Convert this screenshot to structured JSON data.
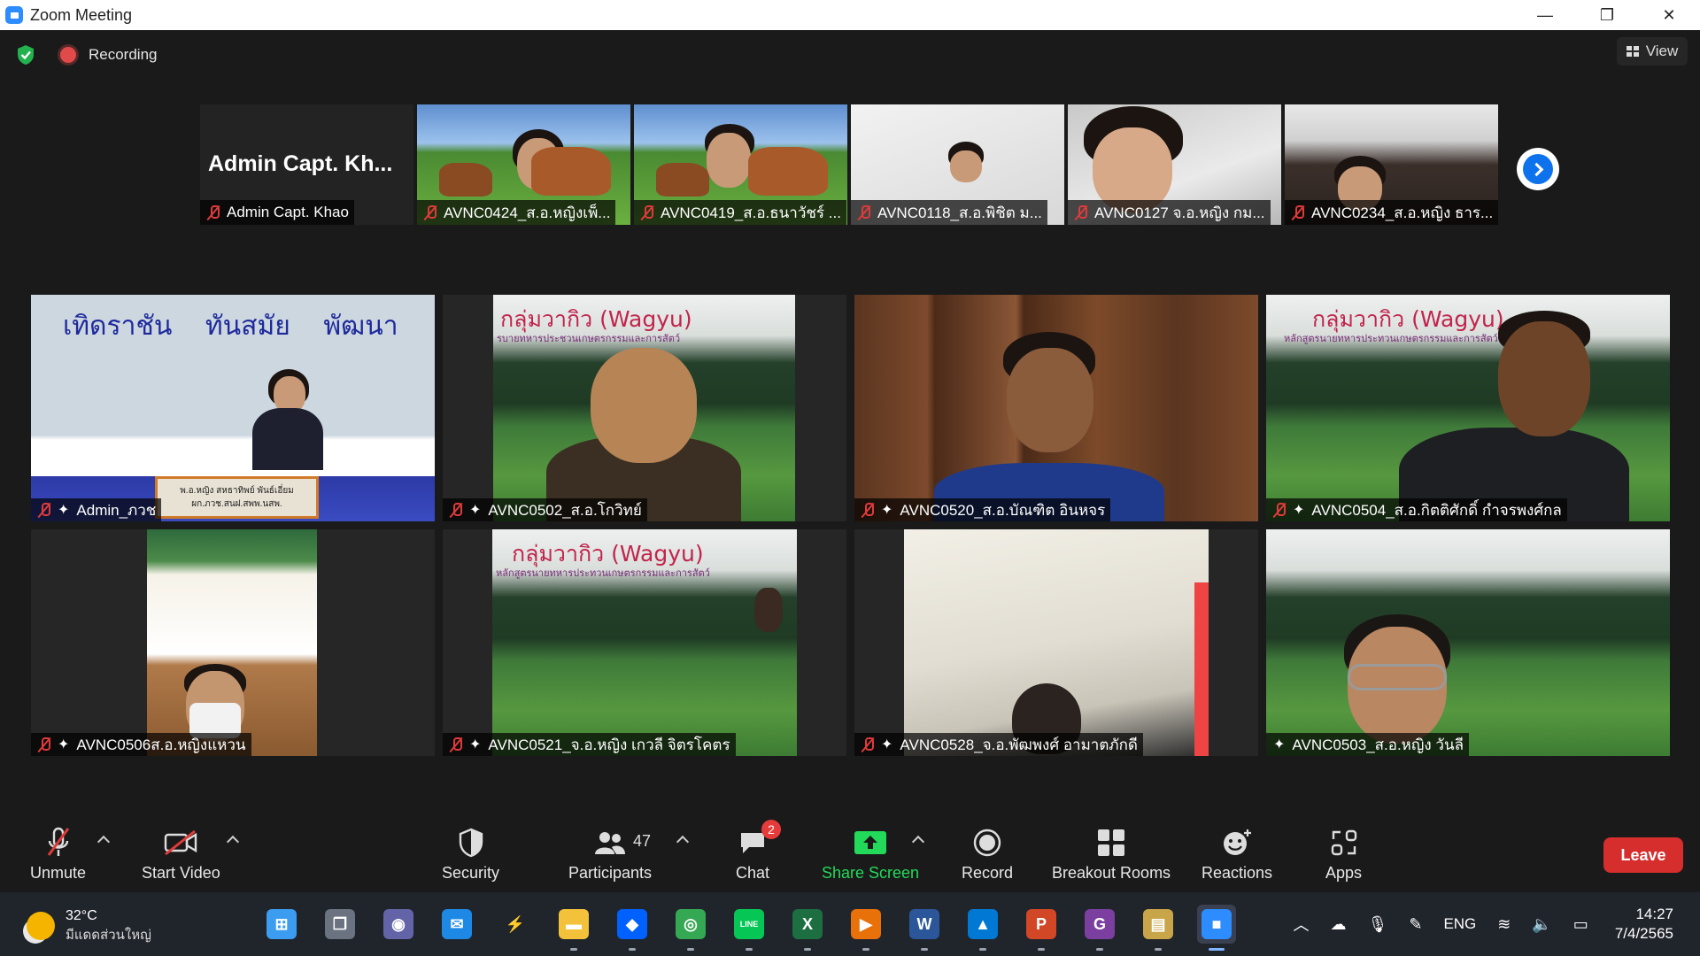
{
  "window": {
    "title": "Zoom Meeting",
    "minimize": "—",
    "maximize": "❐",
    "close": "✕"
  },
  "meeting": {
    "recording_label": "Recording",
    "view_label": "View"
  },
  "filmstrip": [
    {
      "name": "Admin Capt. Khao",
      "big_name": "Admin Capt. Kh...",
      "muted": true
    },
    {
      "name": "AVNC0424_ส.อ.หญิงเพ็...",
      "muted": true
    },
    {
      "name": "AVNC0419_ส.อ.ธนาวัชร์ ...",
      "muted": true
    },
    {
      "name": "AVNC0118_ส.อ.พิชิต ม...",
      "muted": true
    },
    {
      "name": "AVNC0127 จ.อ.หญิง กม...",
      "muted": true
    },
    {
      "name": "AVNC0234_ส.อ.หญิง ธาร...",
      "muted": true
    }
  ],
  "gallery": [
    {
      "name": "Admin_ภวช",
      "muted": true,
      "stage_text": "เทิดราชัน ทันสมัย พัฒนา",
      "nameplate_1": "พ.อ.หญิง สหธาทิพย์ พันธ์เอี่ยม",
      "nameplate_2": "ผก.ภวช.สนฝ.สพพ.นสพ."
    },
    {
      "name": "AVNC0502_ส.อ.โกวิทย์",
      "muted": true,
      "title": "กลุ่มวากิว (Wagyu)",
      "subtitle": "รบายทหารประชวนเกษตรกรรมและการสัตว์"
    },
    {
      "name": "AVNC0520_ส.อ.บัณฑิต อินหจร",
      "muted": true
    },
    {
      "name": "AVNC0504_ส.อ.กิตติศักดิ์ กำจรพงศ์กล",
      "muted": true,
      "title": "กลุ่มวากิว (Wagyu)",
      "subtitle": "หลักสูตรนายทหารประทวนเกษตรกรรมและการสัตว์"
    },
    {
      "name": "AVNC0506ส.อ.หญิงแหวน",
      "muted": true
    },
    {
      "name": "AVNC0521_จ.อ.หญิง เกวลี จิตรโคตร",
      "muted": true,
      "title": "กลุ่มวากิว (Wagyu)",
      "subtitle": "หลักสูตรนายทหารประทวนเกษตรกรรมและการสัตว์"
    },
    {
      "name": "AVNC0528_จ.อ.พัฒพงศ์ อามาตภักดี",
      "muted": true
    },
    {
      "name": "AVNC0503_ส.อ.หญิง วันลี",
      "muted": false
    }
  ],
  "toolbar": {
    "unmute": "Unmute",
    "start_video": "Start Video",
    "security": "Security",
    "participants": "Participants",
    "participants_count": "47",
    "chat": "Chat",
    "chat_badge": "2",
    "share_screen": "Share Screen",
    "record": "Record",
    "breakout_rooms": "Breakout Rooms",
    "reactions": "Reactions",
    "apps": "Apps",
    "leave": "Leave"
  },
  "taskbar": {
    "temperature": "32°C",
    "weather_desc": "มีแดดส่วนใหญ่",
    "language": "ENG",
    "time": "14:27",
    "date": "7/4/2565",
    "apps": [
      {
        "name": "windows-start",
        "color": "#3b9cf0",
        "glyph": "⊞"
      },
      {
        "name": "task-view",
        "color": "#6b7280",
        "glyph": "❐"
      },
      {
        "name": "teams-chat",
        "color": "#6264a7",
        "glyph": "◉"
      },
      {
        "name": "mail",
        "color": "#1e88e5",
        "glyph": "✉"
      },
      {
        "name": "winamp",
        "color": "#20242b",
        "glyph": "⚡"
      },
      {
        "name": "file-explorer",
        "color": "#f3c13a",
        "glyph": "▬"
      },
      {
        "name": "dropbox",
        "color": "#0061ff",
        "glyph": "◆"
      },
      {
        "name": "chrome",
        "color": "#34a853",
        "glyph": "◎"
      },
      {
        "name": "line",
        "color": "#06c755",
        "glyph": "LINE"
      },
      {
        "name": "excel",
        "color": "#1d6f42",
        "glyph": "X"
      },
      {
        "name": "video-player",
        "color": "#e8710a",
        "glyph": "▶"
      },
      {
        "name": "word",
        "color": "#2b579a",
        "glyph": "W"
      },
      {
        "name": "photos",
        "color": "#0078d4",
        "glyph": "▲"
      },
      {
        "name": "powerpoint",
        "color": "#d24726",
        "glyph": "P"
      },
      {
        "name": "pdf-reader",
        "color": "#7b3fa0",
        "glyph": "G"
      },
      {
        "name": "image-viewer",
        "color": "#c9a54a",
        "glyph": "▤"
      },
      {
        "name": "zoom",
        "color": "#2d8cff",
        "glyph": "■"
      }
    ]
  },
  "colors": {
    "accent_blue": "#0e72ed",
    "share_green": "#23d959",
    "leave_red": "#d62d2d",
    "mute_red": "#e03a3a"
  }
}
